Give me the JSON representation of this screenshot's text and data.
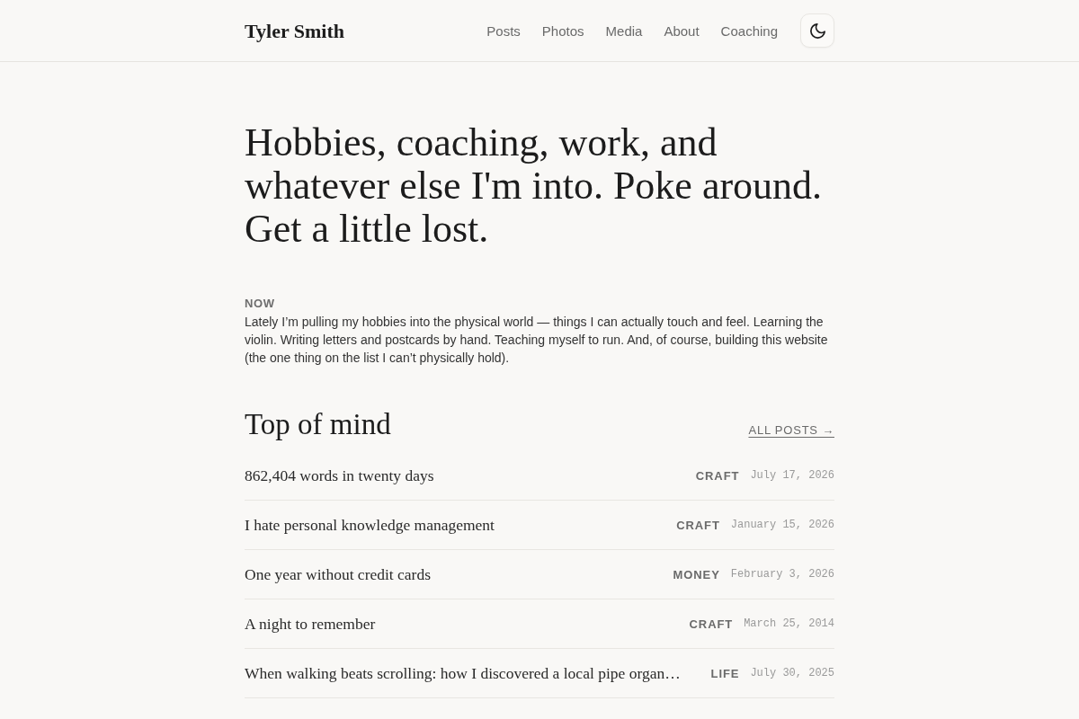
{
  "header": {
    "site_title": "Tyler Smith",
    "nav": [
      "Posts",
      "Photos",
      "Media",
      "About",
      "Coaching"
    ]
  },
  "hero": {
    "headline": "Hobbies, coaching, work, and whatever else I'm into. Poke around. Get a little lost."
  },
  "now": {
    "label": "NOW",
    "text": "Lately I’m pulling my hobbies into the physical world — things I can actually touch and feel. Learning the violin. Writing letters and postcards by hand. Teaching myself to run. And, of course, building this website (the one thing on the list I can’t physically hold)."
  },
  "top_of_mind": {
    "heading": "Top of mind",
    "all_posts_link": "ALL POSTS →",
    "posts": [
      {
        "title": "862,404 words in twenty days",
        "category": "CRAFT",
        "date": "July 17, 2026"
      },
      {
        "title": "I hate personal knowledge management",
        "category": "CRAFT",
        "date": "January 15, 2026"
      },
      {
        "title": "One year without credit cards",
        "category": "MONEY",
        "date": "February 3, 2026"
      },
      {
        "title": "A night to remember",
        "category": "CRAFT",
        "date": "March 25, 2014"
      },
      {
        "title": "When walking beats scrolling: how I discovered a local pipe organ…",
        "category": "LIFE",
        "date": "July 30, 2025"
      }
    ]
  }
}
